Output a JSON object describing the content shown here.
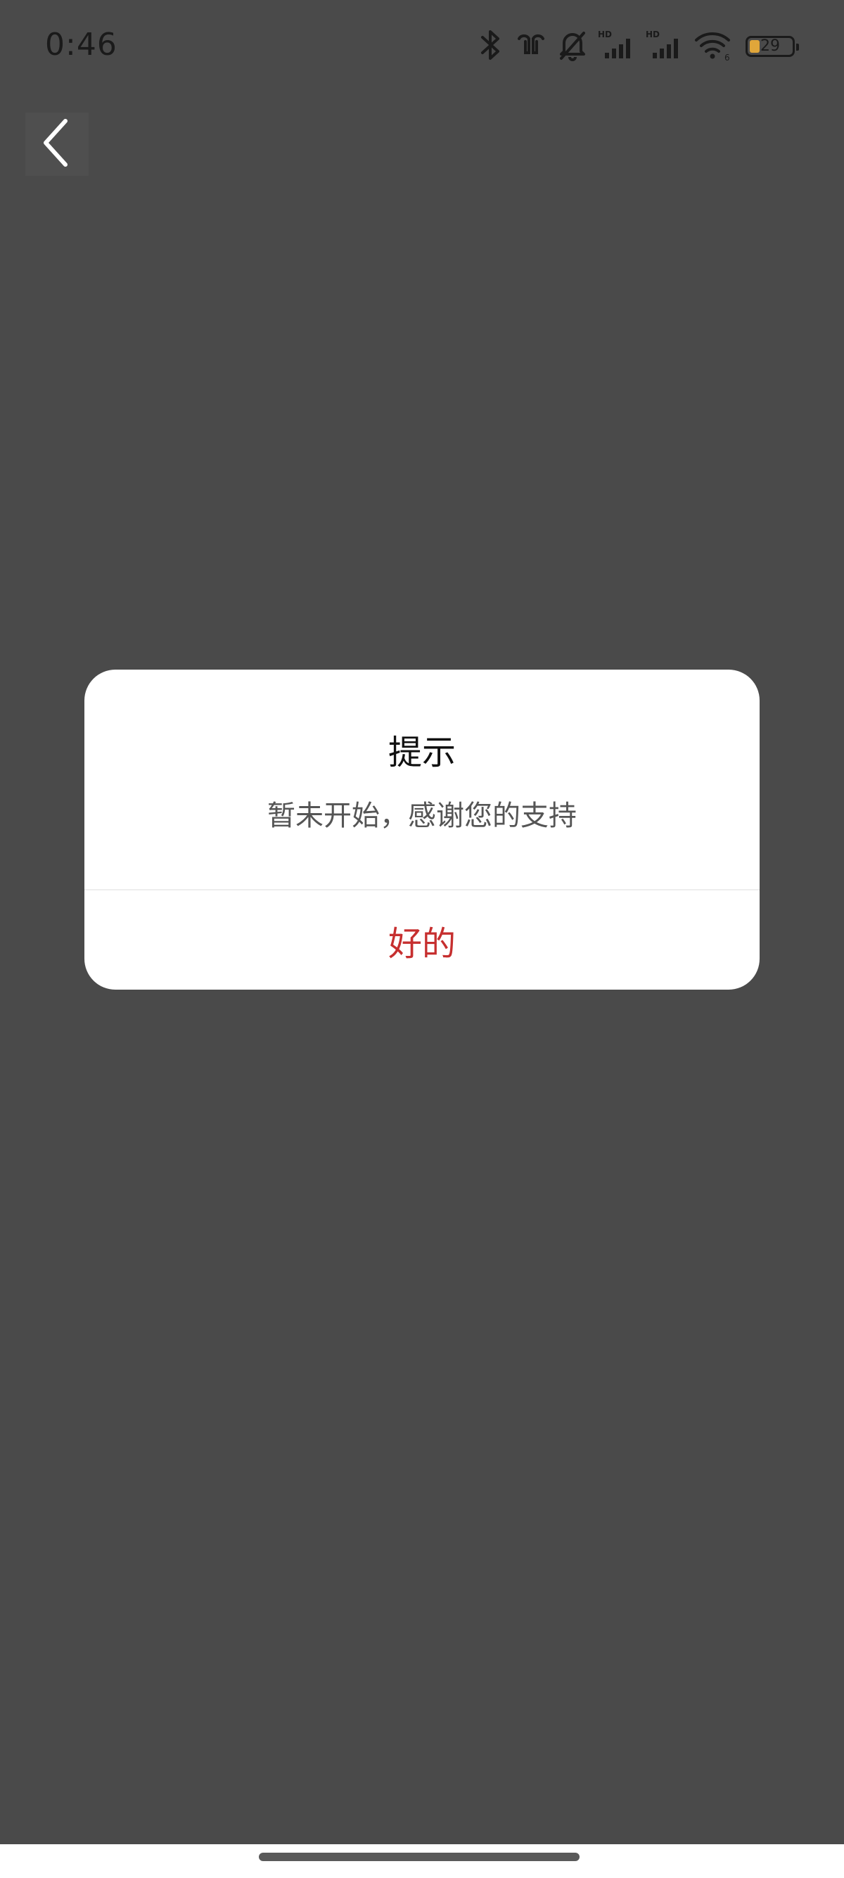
{
  "status_bar": {
    "time": "0:46",
    "battery_level": "29",
    "icons": [
      "bluetooth-icon",
      "earbuds-icon",
      "mute-bell-icon",
      "hd-signal-icon",
      "hd-signal-icon",
      "wifi-icon",
      "battery-icon"
    ],
    "signal_hd_label": "HD",
    "wifi_sub_label": "6"
  },
  "nav": {
    "back_icon": "chevron-left-icon"
  },
  "dialog": {
    "title": "提示",
    "message": "暂未开始，感谢您的支持",
    "ok_label": "好的",
    "ok_color": "#c62f2f"
  },
  "colors": {
    "overlay_background": "#4a4a4a",
    "dialog_background": "#ffffff"
  }
}
